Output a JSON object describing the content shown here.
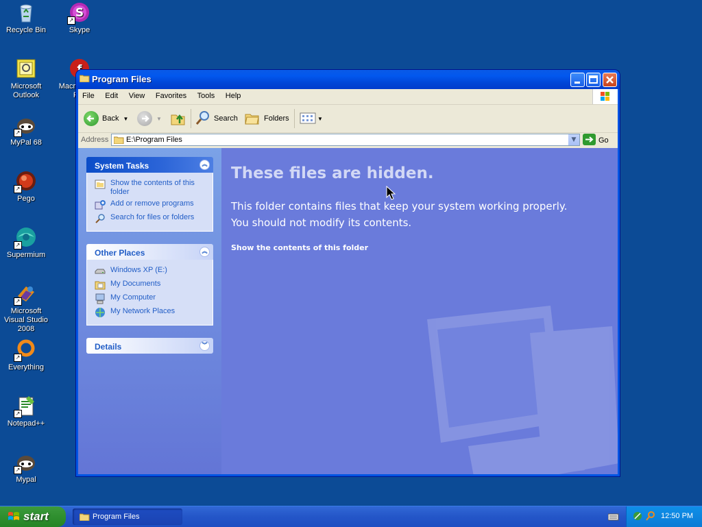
{
  "desktop": {
    "icons": [
      {
        "label": "Recycle Bin",
        "icon": "recycle-bin-icon"
      },
      {
        "label": "Skype",
        "icon": "skype-icon"
      },
      {
        "label": "Microsoft Outlook",
        "icon": "outlook-icon"
      },
      {
        "label": "Macromedia Fl...",
        "icon": "flash-icon"
      },
      {
        "label": "MyPal 68",
        "icon": "mypal-icon"
      },
      {
        "label": "Pego",
        "icon": "pego-icon"
      },
      {
        "label": "Supermium",
        "icon": "supermium-icon"
      },
      {
        "label": "Microsoft Visual Studio 2008",
        "icon": "visual-studio-icon"
      },
      {
        "label": "Everything",
        "icon": "everything-icon"
      },
      {
        "label": "Notepad++",
        "icon": "notepadpp-icon"
      },
      {
        "label": "Mypal",
        "icon": "mypal-icon"
      }
    ]
  },
  "window": {
    "title": "Program Files",
    "menu": [
      "File",
      "Edit",
      "View",
      "Favorites",
      "Tools",
      "Help"
    ],
    "toolbar": {
      "back": "Back",
      "search": "Search",
      "folders": "Folders"
    },
    "address": {
      "label": "Address",
      "value": "E:\\Program Files",
      "go": "Go"
    },
    "system_tasks": {
      "title": "System Tasks",
      "items": [
        {
          "label": "Show the contents of this folder",
          "icon": "folder-view-icon"
        },
        {
          "label": "Add or remove programs",
          "icon": "add-remove-icon"
        },
        {
          "label": "Search for files or folders",
          "icon": "search-icon"
        }
      ]
    },
    "other_places": {
      "title": "Other Places",
      "items": [
        {
          "label": "Windows XP (E:)",
          "icon": "drive-icon"
        },
        {
          "label": "My Documents",
          "icon": "my-documents-icon"
        },
        {
          "label": "My Computer",
          "icon": "my-computer-icon"
        },
        {
          "label": "My Network Places",
          "icon": "network-places-icon"
        }
      ]
    },
    "details": {
      "title": "Details"
    },
    "content": {
      "heading": "These files are hidden.",
      "message_line1": "This folder contains files that keep your system working properly.",
      "message_line2": "You should not modify its contents.",
      "link": "Show the contents of this folder"
    }
  },
  "taskbar": {
    "start": "start",
    "task": "Program Files",
    "clock": "12:50 PM"
  },
  "colors": {
    "desktop": "#0c4b96",
    "content_bg": "#6a7bdb",
    "link_blue": "#215dc6"
  }
}
